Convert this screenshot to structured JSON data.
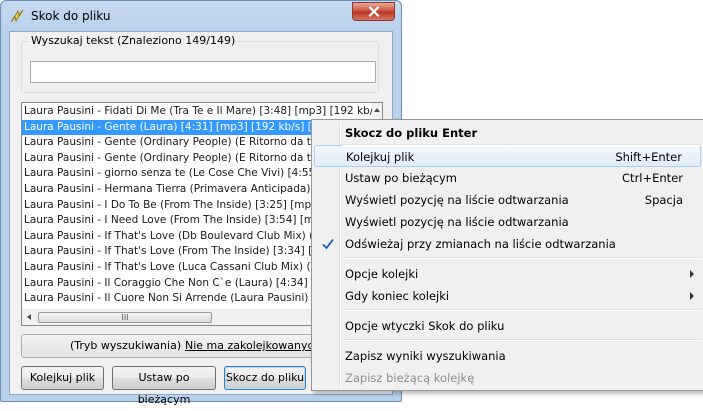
{
  "window": {
    "title": "Skok do pliku",
    "search_group_label": "Wyszukaj tekst  (Znaleziono 149/149)",
    "search_value": "",
    "list_items": [
      "Laura Pausini - Fidati Di Me (Tra Te e Il Mare) [3:48] [mp3] [192 kb/s] [Pop]",
      "Laura Pausini - Gente (Laura) [4:31] [mp3] [192 kb/s] [Pop]",
      "Laura Pausini - Gente (Ordinary People) (E Ritorno da te) [4:",
      "Laura Pausini - Gente (Ordinary People) (E Ritorno da te) [4:",
      "Laura Pausini - giorno senza te (Le Cose Che Vivi) [4:55] [m",
      "Laura Pausini - Hermana Tierra (Primavera Anticipada) [4:08",
      "Laura Pausini - I Do To Be (From The Inside) [3:25] [mp3] [1",
      "Laura Pausini - I Need Love (From The Inside) [3:54] [mp3] [1",
      "Laura Pausini - If That's Love (Db Boulevard Club Mix) (The",
      "Laura Pausini - If That's Love (From The Inside) [3:34] [mp3",
      "Laura Pausini - If That's Love (Luca Cassani Club Mix) (The",
      "Laura Pausini - Il Coraggio Che Non C`e (Laura) [4:34] [mp3",
      "Laura Pausini - Il Cuore Non Si Arrende (Laura Pausini) [4:28"
    ],
    "selected_index": 1,
    "scroll_thumb_grip": "III",
    "status_mode": "(Tryb wyszukiwania)",
    "status_queue": "Nie ma zakolejkowanych p",
    "buttons": {
      "queue": "Kolejkuj plik",
      "set_current": "Ustaw po bieżącym",
      "jump": "Skocz do pliku"
    }
  },
  "context_menu": {
    "items": [
      {
        "label": "Skocz do pliku Enter",
        "shortcut": "",
        "bold": true
      },
      {
        "label": "Kolejkuj plik",
        "shortcut": "Shift+Enter",
        "hover": true
      },
      {
        "label": "Ustaw po bieżącym",
        "shortcut": "Ctrl+Enter"
      },
      {
        "label": "Wyświetl pozycję na liście odtwarzania",
        "shortcut": "Spacja"
      },
      {
        "label": "Wyświetl pozycję na liście odtwarzania",
        "shortcut": ""
      },
      {
        "label": "Odświeżaj przy zmianach na liście odtwarzania",
        "shortcut": "",
        "checked": true
      },
      {
        "label": "Opcje kolejki",
        "submenu": true
      },
      {
        "label": "Gdy koniec kolejki",
        "submenu": true
      },
      {
        "label": "Opcje wtyczki Skok do pliku"
      },
      {
        "label": "Zapisz wyniki wyszukiwania"
      },
      {
        "label": "Zapisz bieżącą kolejkę",
        "disabled": true
      }
    ]
  },
  "colors": {
    "selection": "#3399ff",
    "menu_hover_border": "#aecff7",
    "check_mark": "#1c5db8"
  }
}
